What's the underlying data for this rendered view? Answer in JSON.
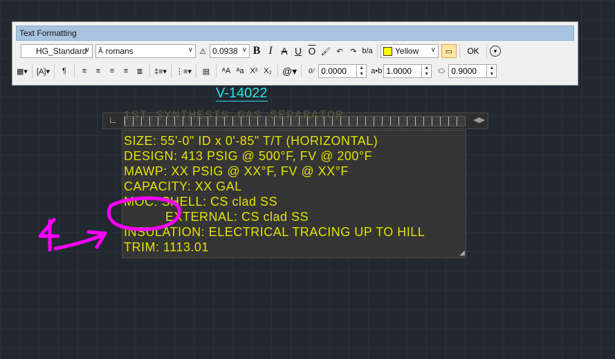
{
  "window": {
    "title": "Text Formatting"
  },
  "toolbar_row1": {
    "style": "HG_Standard",
    "font": "romans",
    "text_height": "0.0938",
    "bold": "B",
    "italic": "I",
    "strike": "A",
    "underline": "U",
    "overline": "O",
    "color": "Yellow",
    "ok_label": "OK"
  },
  "toolbar_row2": {
    "oblique_value": "0.0000",
    "tracking_value": "1.0000",
    "width_factor_value": "0.9000"
  },
  "tag": "V-14022",
  "ghost_title": "1ST SYNTHESIS GAS SEPARATOR",
  "editor": {
    "lines": [
      "SIZE: 55'-0\" ID x 0'-85\" T/T (HORIZONTAL)",
      "DESIGN: 413 PSIG @ 500°F, FV @ 200°F",
      "MAWP: XX PSIG @ XX°F, FV @ XX°F",
      "CAPACITY: XX GAL",
      "MOC: SHELL: CS clad SS",
      "EXTERNAL: CS clad SS",
      "INSULATION: ELECTRICAL TRACING UP TO HILL",
      "TRIM: 1113.01"
    ]
  },
  "colors": {
    "background": "#212830",
    "text_yellow": "#e3e300",
    "tag_cyan": "#2de3e6",
    "annotation_magenta": "#ff00ff"
  }
}
